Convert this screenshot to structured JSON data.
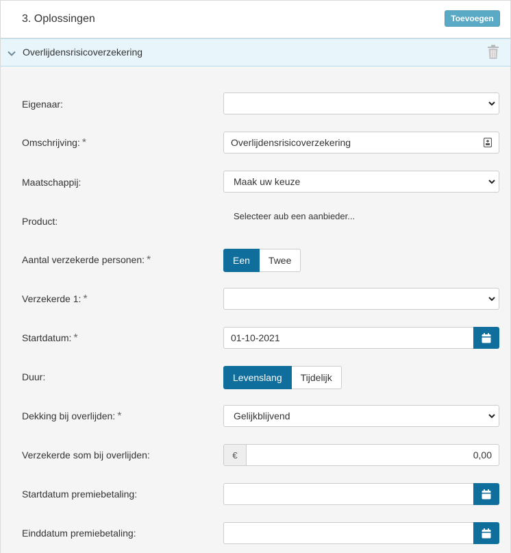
{
  "header": {
    "title": "3. Oplossingen",
    "add_label": "Toevoegen"
  },
  "section": {
    "title": "Overlijdensrisicoverzekering"
  },
  "icons": {
    "chevron": "chevron-down-icon",
    "trash": "trash-icon",
    "calendar": "calendar-icon",
    "caret": "caret-down-icon"
  },
  "colors": {
    "accent": "#0f6e9b",
    "add_button": "#5aa9c5",
    "section_bg": "#e8f5fb"
  },
  "form": {
    "eigenaar": {
      "label": "Eigenaar:",
      "value": ""
    },
    "omschrijving": {
      "label": "Omschrijving:",
      "required": "*",
      "value": "Overlijdensrisicoverzekering"
    },
    "maatschappij": {
      "label": "Maatschappij:",
      "value": "Maak uw keuze"
    },
    "product": {
      "label": "Product:",
      "value": "Selecteer aub een aanbieder..."
    },
    "aantal": {
      "label": "Aantal verzekerde personen:",
      "required": "*",
      "options": [
        "Een",
        "Twee"
      ],
      "selected": "Een"
    },
    "verzekerde1": {
      "label": "Verzekerde 1:",
      "required": "*",
      "value": ""
    },
    "startdatum": {
      "label": "Startdatum:",
      "required": "*",
      "value": "01-10-2021"
    },
    "duur": {
      "label": "Duur:",
      "options": [
        "Levenslang",
        "Tijdelijk"
      ],
      "selected": "Levenslang"
    },
    "dekking": {
      "label": "Dekking bij overlijden:",
      "required": "*",
      "value": "Gelijkblijvend"
    },
    "som": {
      "label": "Verzekerde som bij overlijden:",
      "currency": "€",
      "value": "0,00"
    },
    "start_premie": {
      "label": "Startdatum premiebetaling:",
      "value": ""
    },
    "eind_premie": {
      "label": "Einddatum premiebetaling:",
      "value": ""
    }
  }
}
